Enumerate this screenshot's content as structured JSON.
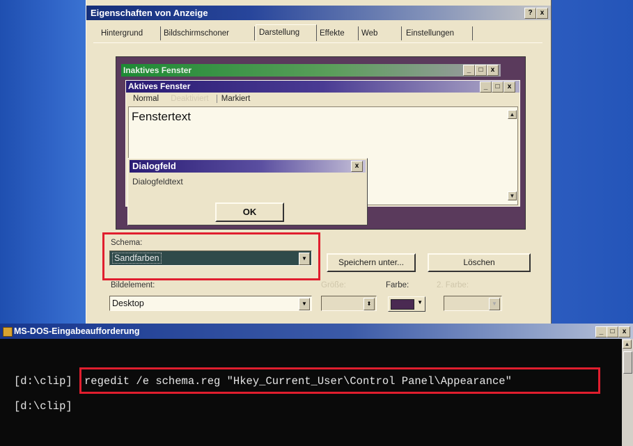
{
  "dialog": {
    "title": "Eigenschaften von Anzeige",
    "help_btn": "?",
    "close_btn": "x",
    "tabs": [
      "Hintergrund",
      "Bildschirmschoner",
      "Darstellung",
      "Effekte",
      "Web",
      "Einstellungen"
    ],
    "active_tab": "Darstellung"
  },
  "preview": {
    "inactive_title": "Inaktives Fenster",
    "active_title": "Aktives Fenster",
    "menu_normal": "Normal",
    "menu_disabled": "Deaktiviert",
    "menu_selected": "Markiert",
    "window_text": "Fenstertext",
    "dialog_title": "Dialogfeld",
    "dialog_text": "Dialogfeldtext",
    "ok": "OK",
    "min": "_",
    "max": "□",
    "close": "x"
  },
  "scheme": {
    "label": "Schema:",
    "value": "Sandfarben",
    "save_as": "Speichern unter...",
    "delete": "Löschen"
  },
  "element": {
    "label": "Bildelement:",
    "value": "Desktop",
    "size_label": "Größe:",
    "color_label": "Farbe:",
    "color2_label": "2. Farbe:",
    "color_value": "#4a2a52"
  },
  "dos": {
    "title": "MS-DOS-Eingabeaufforderung",
    "prompt1": "[d:\\clip]",
    "command": "regedit /e schema.reg \"Hkey_Current_User\\Control Panel\\Appearance\"",
    "prompt2": "[d:\\clip]",
    "min": "_",
    "max": "□",
    "close": "x"
  },
  "colors": {
    "highlight": "#e01e2e",
    "scheme_bg": "#2f4a4a"
  }
}
